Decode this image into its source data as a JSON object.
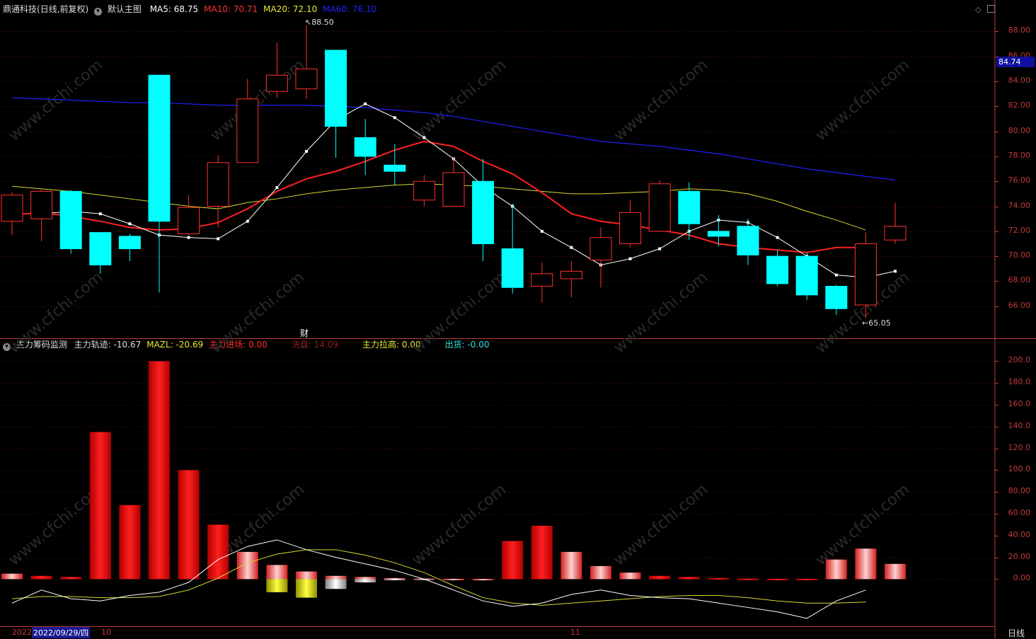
{
  "main": {
    "symbol": "鼎通科技",
    "period": "(日线,前复权)",
    "template": "默认主图",
    "ma": [
      {
        "label": "MA5:",
        "value": "68.75",
        "color": "#ffffff"
      },
      {
        "label": "MA10:",
        "value": "70.71",
        "color": "#ff3030"
      },
      {
        "label": "MA20:",
        "value": "72.10",
        "color": "#e8e830"
      },
      {
        "label": "MA60:",
        "value": "76.10",
        "color": "#2020ff"
      }
    ],
    "y_ticks": [
      "88.00",
      "86.00",
      "84.00",
      "82.00",
      "80.00",
      "78.00",
      "76.00",
      "74.00",
      "72.00",
      "70.00",
      "68.00",
      "66.00"
    ],
    "price_tag": "84.74",
    "high_mark": "88.50",
    "low_mark": "65.05",
    "event_mark": "财"
  },
  "sub": {
    "title": "主力筹码监测",
    "items": [
      {
        "label": "主力轨迹:",
        "value": "-10.67",
        "color": "#dddddd"
      },
      {
        "label": "MAZL:",
        "value": "-20.69",
        "color": "#e8e830"
      },
      {
        "label": "主力进场:",
        "value": "0.00",
        "color": "#ff3030"
      },
      {
        "label": "洗盘:",
        "value": "14.09",
        "color": "#8a2020"
      },
      {
        "label": "主力拉高:",
        "value": "0.00",
        "color": "#e8e830"
      },
      {
        "label": "出货:",
        "value": "-0.00",
        "color": "#30e0e0"
      }
    ],
    "y_ticks": [
      "200.0",
      "180.0",
      "160.0",
      "140.0",
      "120.0",
      "100.0",
      "80.00",
      "60.00",
      "40.00",
      "20.00",
      "0.00"
    ]
  },
  "bottom": {
    "year_prefix": "2022",
    "cursor_date": "2022/09/29/四",
    "month_10": "10",
    "month_11": "11",
    "period_label": "日线"
  },
  "watermark": "www.cfchi.com",
  "chart_data": {
    "type": "candlestick",
    "ylim": [
      64.0,
      89.5
    ],
    "candles": [
      {
        "o": 72.8,
        "c": 74.9,
        "h": 75.1,
        "l": 71.7
      },
      {
        "o": 73.0,
        "c": 75.2,
        "h": 75.4,
        "l": 71.2
      },
      {
        "o": 75.2,
        "c": 70.6,
        "h": 75.3,
        "l": 70.2
      },
      {
        "o": 71.9,
        "c": 69.3,
        "h": 71.9,
        "l": 68.6
      },
      {
        "o": 71.6,
        "c": 70.6,
        "h": 71.8,
        "l": 69.6
      },
      {
        "o": 84.5,
        "c": 72.8,
        "h": 84.5,
        "l": 67.1
      },
      {
        "o": 71.8,
        "c": 73.9,
        "h": 74.9,
        "l": 71.7
      },
      {
        "o": 74.0,
        "c": 77.5,
        "h": 78.1,
        "l": 72.3
      },
      {
        "o": 77.5,
        "c": 82.6,
        "h": 84.2,
        "l": 77.5
      },
      {
        "o": 83.2,
        "c": 84.5,
        "h": 87.1,
        "l": 82.7
      },
      {
        "o": 83.4,
        "c": 85.0,
        "h": 88.5,
        "l": 82.6
      },
      {
        "o": 86.5,
        "c": 80.4,
        "h": 86.5,
        "l": 77.9
      },
      {
        "o": 79.5,
        "c": 78.0,
        "h": 81.0,
        "l": 76.5
      },
      {
        "o": 77.3,
        "c": 76.8,
        "h": 79.0,
        "l": 75.7
      },
      {
        "o": 74.5,
        "c": 76.0,
        "h": 76.5,
        "l": 74.0
      },
      {
        "o": 74.0,
        "c": 76.7,
        "h": 77.9,
        "l": 74.0
      },
      {
        "o": 76.0,
        "c": 71.0,
        "h": 77.8,
        "l": 69.6
      },
      {
        "o": 70.6,
        "c": 67.5,
        "h": 74.2,
        "l": 67.0
      },
      {
        "o": 67.6,
        "c": 68.6,
        "h": 69.5,
        "l": 66.3
      },
      {
        "o": 68.2,
        "c": 68.8,
        "h": 69.6,
        "l": 66.7
      },
      {
        "o": 69.7,
        "c": 71.5,
        "h": 72.3,
        "l": 67.5
      },
      {
        "o": 71.0,
        "c": 73.5,
        "h": 74.5,
        "l": 70.7
      },
      {
        "o": 72.0,
        "c": 75.8,
        "h": 76.1,
        "l": 72.0
      },
      {
        "o": 75.2,
        "c": 72.6,
        "h": 75.9,
        "l": 71.3
      },
      {
        "o": 72.0,
        "c": 71.6,
        "h": 73.3,
        "l": 70.8
      },
      {
        "o": 72.4,
        "c": 70.1,
        "h": 73.0,
        "l": 69.3
      },
      {
        "o": 70.0,
        "c": 67.8,
        "h": 70.5,
        "l": 67.6
      },
      {
        "o": 70.0,
        "c": 66.9,
        "h": 70.3,
        "l": 66.5
      },
      {
        "o": 67.6,
        "c": 65.8,
        "h": 67.7,
        "l": 65.3
      },
      {
        "o": 66.1,
        "c": 71.0,
        "h": 71.9,
        "l": 65.05
      },
      {
        "o": 71.3,
        "c": 72.4,
        "h": 74.3,
        "l": 71.0
      }
    ],
    "ma5": [
      73.4,
      73.6,
      73.4,
      72.6,
      71.7,
      71.5,
      71.4,
      72.8,
      75.5,
      78.4,
      80.9,
      82.2,
      81.1,
      79.5,
      77.8,
      75.6,
      74.0,
      72.0,
      70.7,
      69.3,
      69.8,
      70.6,
      72.0,
      72.9,
      72.7,
      71.5,
      70.0,
      68.5,
      68.3,
      68.8
    ],
    "ma10": [
      73.3,
      73.5,
      73.2,
      72.8,
      72.3,
      72.1,
      72.2,
      72.7,
      73.8,
      75.2,
      76.2,
      76.8,
      77.6,
      78.5,
      79.2,
      78.8,
      77.6,
      76.6,
      75.1,
      73.4,
      72.8,
      72.5,
      72.1,
      71.7,
      71.0,
      70.7,
      70.5,
      70.3,
      70.7,
      70.7
    ],
    "ma20": [
      75.6,
      75.4,
      75.2,
      74.9,
      74.6,
      74.3,
      74.0,
      73.8,
      74.3,
      74.6,
      75.0,
      75.3,
      75.5,
      75.7,
      75.8,
      75.7,
      75.6,
      75.4,
      75.2,
      75.0,
      75.0,
      75.1,
      75.2,
      75.4,
      75.3,
      75.0,
      74.4,
      73.6,
      72.9,
      72.1
    ],
    "ma60": [
      82.7,
      82.6,
      82.5,
      82.4,
      82.3,
      82.3,
      82.2,
      82.1,
      82.1,
      82.1,
      82.1,
      82.0,
      81.9,
      81.7,
      81.5,
      81.2,
      80.8,
      80.4,
      80.0,
      79.6,
      79.2,
      79.0,
      78.8,
      78.5,
      78.2,
      77.8,
      77.4,
      77.0,
      76.7,
      76.4,
      76.1
    ],
    "sub_ylim": [
      -40,
      210
    ],
    "sub_bars": [
      5,
      3,
      2,
      135,
      68,
      200,
      100,
      50,
      25,
      13,
      7,
      3,
      2,
      1,
      0.5,
      0.3,
      0.2,
      35,
      49,
      25,
      12,
      6,
      3,
      2,
      1,
      0.5,
      0.3,
      0.3,
      18,
      28,
      14
    ],
    "sub_neg": [
      0,
      0,
      0,
      0,
      0,
      0,
      0,
      0,
      0,
      -12,
      -17,
      -9,
      -3,
      -1,
      -0.5,
      0,
      0,
      0,
      0,
      0,
      0,
      0,
      0,
      0,
      0,
      0,
      0,
      0,
      0,
      0,
      0
    ],
    "sub_white": [
      -22,
      -10,
      -18,
      -20,
      -15,
      -12,
      -3,
      18,
      30,
      36,
      27,
      20,
      14,
      8,
      0,
      -10,
      -20,
      -25,
      -22,
      -14,
      -10,
      -15,
      -17,
      -18,
      -22,
      -26,
      -30,
      -36,
      -20,
      -10
    ],
    "sub_yellow": [
      -18,
      -16,
      -16,
      -17,
      -17,
      -16,
      -10,
      1,
      15,
      23,
      27,
      27,
      22,
      15,
      6,
      -6,
      -17,
      -22,
      -24,
      -22,
      -20,
      -18,
      -16,
      -15,
      -15,
      -17,
      -20,
      -22,
      -22,
      -21
    ]
  }
}
